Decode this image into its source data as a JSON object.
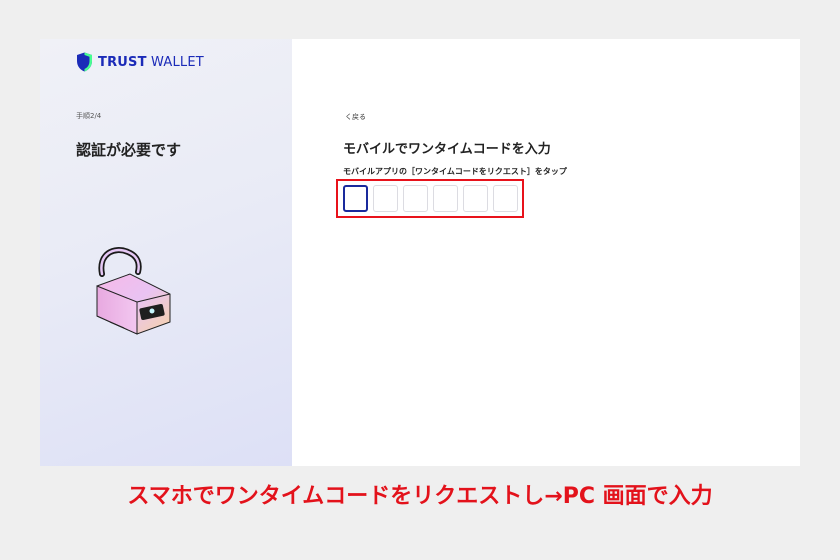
{
  "brand": {
    "logo_bold": "TRUST",
    "logo_light": "WALLET",
    "color": "#1b2bb8"
  },
  "left": {
    "step": "手順2/4",
    "title": "認証が必要です"
  },
  "main": {
    "back": "く戻る",
    "title": "モバイルでワンタイムコードを入力",
    "instruction": "モバイルアプリの［ワンタイムコードをリクエスト］をタップ",
    "otp_fields": [
      "",
      "",
      "",
      "",
      "",
      ""
    ]
  },
  "caption": {
    "text": "スマホでワンタイムコードをリクエストし→PC 画面で入力",
    "color": "#e3121b"
  }
}
